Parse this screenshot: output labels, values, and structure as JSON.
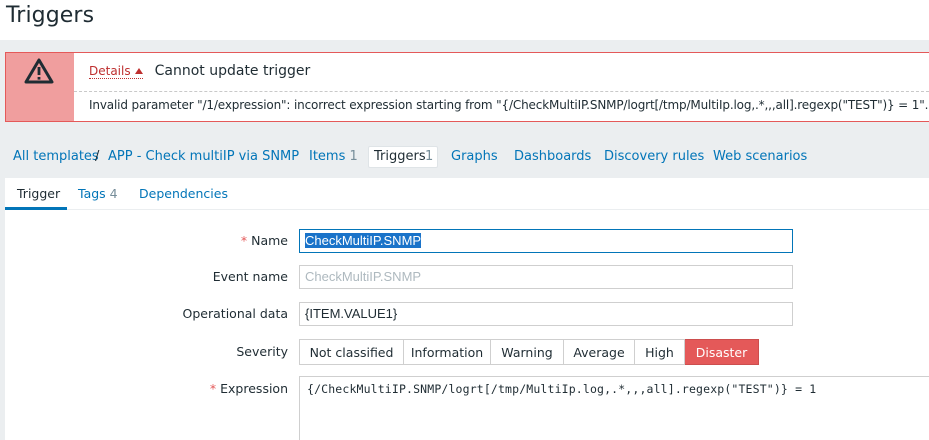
{
  "page": {
    "title": "Triggers"
  },
  "error": {
    "details_label": "Details",
    "headline": "Cannot update trigger",
    "detail": "Invalid parameter \"/1/expression\": incorrect expression starting from \"{/CheckMultiIP.SNMP/logrt[/tmp/MultiIp.log,.*,,,all].regexp(\"TEST\")} = 1\"."
  },
  "nav": {
    "all_templates": "All templates",
    "separator": "/",
    "template_name": "APP - Check multiIP via SNMP",
    "items_label": "Items",
    "items_count": "1",
    "triggers_label": "Triggers",
    "triggers_count": "1",
    "graphs": "Graphs",
    "dashboards": "Dashboards",
    "discovery_rules": "Discovery rules",
    "web_scenarios": "Web scenarios"
  },
  "tabs": {
    "trigger": "Trigger",
    "tags_label": "Tags",
    "tags_count": "4",
    "dependencies": "Dependencies"
  },
  "form": {
    "required_mark": "*",
    "name_label": "Name",
    "name_value": "CheckMultiIP.SNMP",
    "event_name_label": "Event name",
    "event_name_placeholder": "CheckMultiIP.SNMP",
    "operational_data_label": "Operational data",
    "operational_data_value": "{ITEM.VALUE1}",
    "severity_label": "Severity",
    "severity_options": [
      "Not classified",
      "Information",
      "Warning",
      "Average",
      "High",
      "Disaster"
    ],
    "severity_selected": "Disaster",
    "expression_label": "Expression",
    "expression_value": "{/CheckMultiIP.SNMP/logrt[/tmp/MultiIp.log,.*,,,all].regexp(\"TEST\")} = 1"
  },
  "colors": {
    "link": "#0275b8",
    "error_border": "#e45959",
    "error_icon_bg": "#f09e9e",
    "disaster": "#e45959"
  },
  "icons": {
    "error": "warning-triangle-icon",
    "details_toggle": "arrow-up-icon"
  }
}
